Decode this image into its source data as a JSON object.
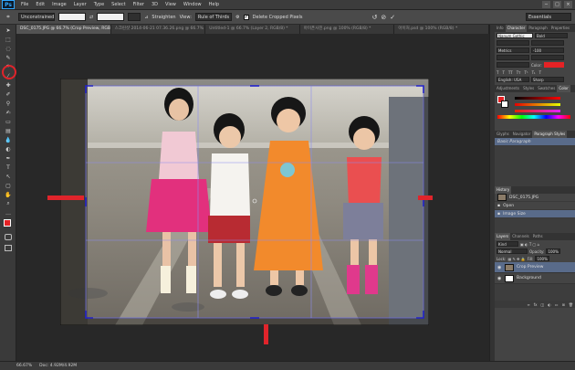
{
  "app": {
    "logo": "Ps",
    "menu": [
      "File",
      "Edit",
      "Image",
      "Layer",
      "Type",
      "Select",
      "Filter",
      "3D",
      "View",
      "Window",
      "Help"
    ],
    "window_buttons": [
      "−",
      "□",
      "×"
    ]
  },
  "options_bar": {
    "ratio_select": "Unconstrained",
    "straighten_label": "Straighten",
    "view_label": "View:",
    "view_select": "Rule of Thirds",
    "delete_cropped_label": "Delete Cropped Pixels",
    "commit_icon": "✓",
    "cancel_icon": "⊘",
    "reset_icon": "↺",
    "workspace": "Essentials"
  },
  "tabs": [
    {
      "label": "DSC_0175.JPG @ 66.7% (Crop Preview, RGB/8) *",
      "active": true
    },
    {
      "label": "스크린샷 2014-06-21 07.36.26.png @ 66.7% (RGB/8) *",
      "active": false
    },
    {
      "label": "Untitled-1 @ 66.7% (Layer 2, RGB/8) *",
      "active": false
    },
    {
      "label": "아이폰사진.png @ 100% (RGB/8) *",
      "active": false
    },
    {
      "label": "아이처.psd @ 100% (RGB/8) *",
      "active": false
    }
  ],
  "status": {
    "zoom": "66.67%",
    "doc": "Doc: 4.92M/4.92M"
  },
  "character_panel": {
    "tabs": [
      "Info",
      "Character",
      "Paragraph",
      "Properties"
    ],
    "font": "Nanum Gothic",
    "style": "Bold",
    "kerning": "Metrics",
    "tracking": "-100",
    "color_label": "Color:",
    "lang": "English: USA",
    "aa": "Sharp"
  },
  "adjustments_panel": {
    "tabs": [
      "Adjustments",
      "Styles",
      "Swatches",
      "Color"
    ]
  },
  "paragraph_styles_panel": {
    "tabs": [
      "Glyphs",
      "Navigator",
      "Paragraph Styles"
    ],
    "item": "Basic Paragraph"
  },
  "history_panel": {
    "title": "History",
    "snapshot": "DSC_0175.JPG",
    "items": [
      "Open",
      "Image Size"
    ]
  },
  "layers_panel": {
    "tabs": [
      "Layers",
      "Channels",
      "Paths"
    ],
    "kind": "Kind",
    "blend": "Normal",
    "opacity_label": "Opacity:",
    "opacity": "100%",
    "lock_label": "Lock:",
    "fill_label": "Fill:",
    "fill": "100%",
    "layers": [
      {
        "name": "Crop Preview",
        "selected": true
      },
      {
        "name": "Background",
        "selected": false
      }
    ]
  },
  "colors": {
    "foreground": "#e52225",
    "background": "#ffffff",
    "annotation": "#e0242b"
  }
}
